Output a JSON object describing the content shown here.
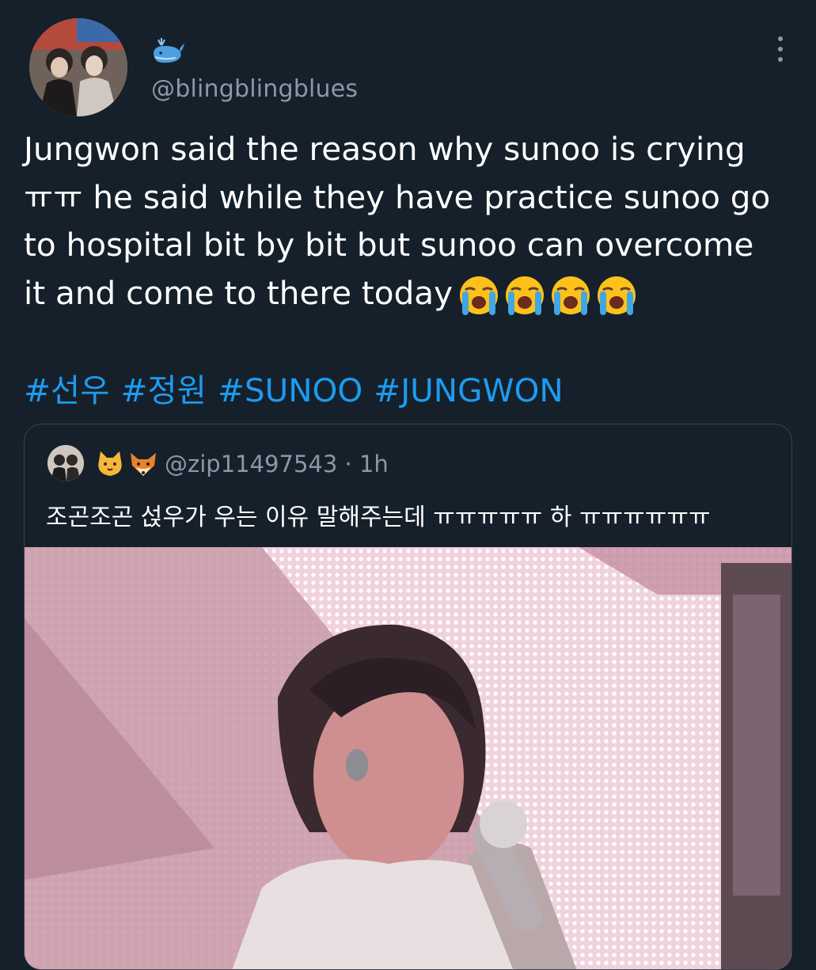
{
  "tweet": {
    "display_name_icon": "whale-icon",
    "handle": "@blingblingblues",
    "text_lines": [
      "Jungwon said the reason why sunoo is crying",
      "ㅠㅠ he said while they have practice sunoo go",
      "to hospital bit by bit but sunoo can overcome",
      "it and come to there today"
    ],
    "trailing_emoji": [
      "loudly-crying-face-icon",
      "loudly-crying-face-icon",
      "loudly-crying-face-icon",
      "loudly-crying-face-icon"
    ],
    "hashtags": [
      "#선우",
      "#정원",
      "#SUNOO",
      "#JUNGWON"
    ],
    "more_icon": "more-vertical-icon"
  },
  "quote": {
    "name_emoji": [
      "cat-face-icon",
      "fox-face-icon"
    ],
    "handle": "@zip11497543",
    "time": "1h",
    "separator": "·",
    "text": "조곤조곤 섡우가 우는 이유 말해주는데 ㅠㅠㅠㅠㅠ 하 ㅠㅠㅠㅠㅠㅠ"
  },
  "colors": {
    "background": "#15202b",
    "text": "#ffffff",
    "secondary_text": "#8b98a5",
    "link": "#1d9bf0",
    "border": "#38444d"
  }
}
